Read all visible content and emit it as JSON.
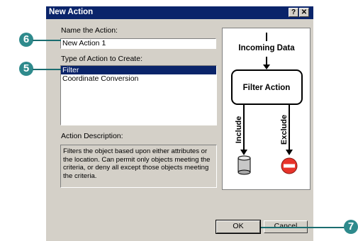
{
  "dialog": {
    "title": "New Action",
    "help_btn": "?",
    "close_btn": "✕"
  },
  "form": {
    "name_label": "Name  the Action:",
    "name_value": "New Action 1",
    "type_label": "Type of Action to Create:",
    "types": [
      "Filter",
      "Coordinate Conversion"
    ],
    "selected_type": "Filter",
    "desc_label": "Action Description:",
    "desc_text": "Filters the object based upon either attributes or the location.  Can permit only objects meeting the criteria, or deny all except those objects meeting the criteria."
  },
  "diagram": {
    "incoming": "Incoming  Data",
    "action": "Filter Action",
    "include": "Include",
    "exclude": "Exclude"
  },
  "buttons": {
    "ok": "OK",
    "cancel": "Cancel"
  },
  "callouts": {
    "c6": "6",
    "c5": "5",
    "c7": "7"
  },
  "colors": {
    "titlebar": "#0a246a",
    "callout": "#2e8a8c",
    "exclude_icon": "#e8332a"
  }
}
